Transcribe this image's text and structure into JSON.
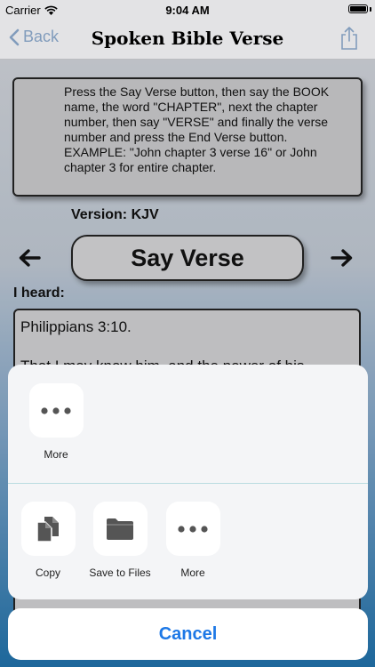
{
  "status_bar": {
    "carrier": "Carrier",
    "time": "9:04 AM",
    "battery_level": 1.0
  },
  "nav": {
    "back_label": "Back",
    "title": "Spoken Bible Verse"
  },
  "instructions": "Press the Say Verse button, then say the BOOK name, the word \"CHAPTER\", next the chapter number, then say \"VERSE\" and finally the verse number and press the End Verse button. EXAMPLE: \"John chapter 3 verse 16\" or John chapter 3 for entire chapter.",
  "version_label": "Version: KJV",
  "say_verse_label": "Say Verse",
  "heard_label": "I heard:",
  "verse": {
    "reference": "Philippians 3:10.",
    "text": "That I may know him, and the power of his"
  },
  "share_sheet": {
    "top_row": [
      {
        "label": "More",
        "icon": "more-icon"
      }
    ],
    "actions": [
      {
        "label": "Copy",
        "icon": "copy-icon"
      },
      {
        "label": "Save to Files",
        "icon": "folder-icon"
      },
      {
        "label": "More",
        "icon": "more-icon"
      }
    ],
    "cancel_label": "Cancel"
  },
  "colors": {
    "accent": "#1d78e6",
    "back_tint": "#8aa6c8"
  }
}
